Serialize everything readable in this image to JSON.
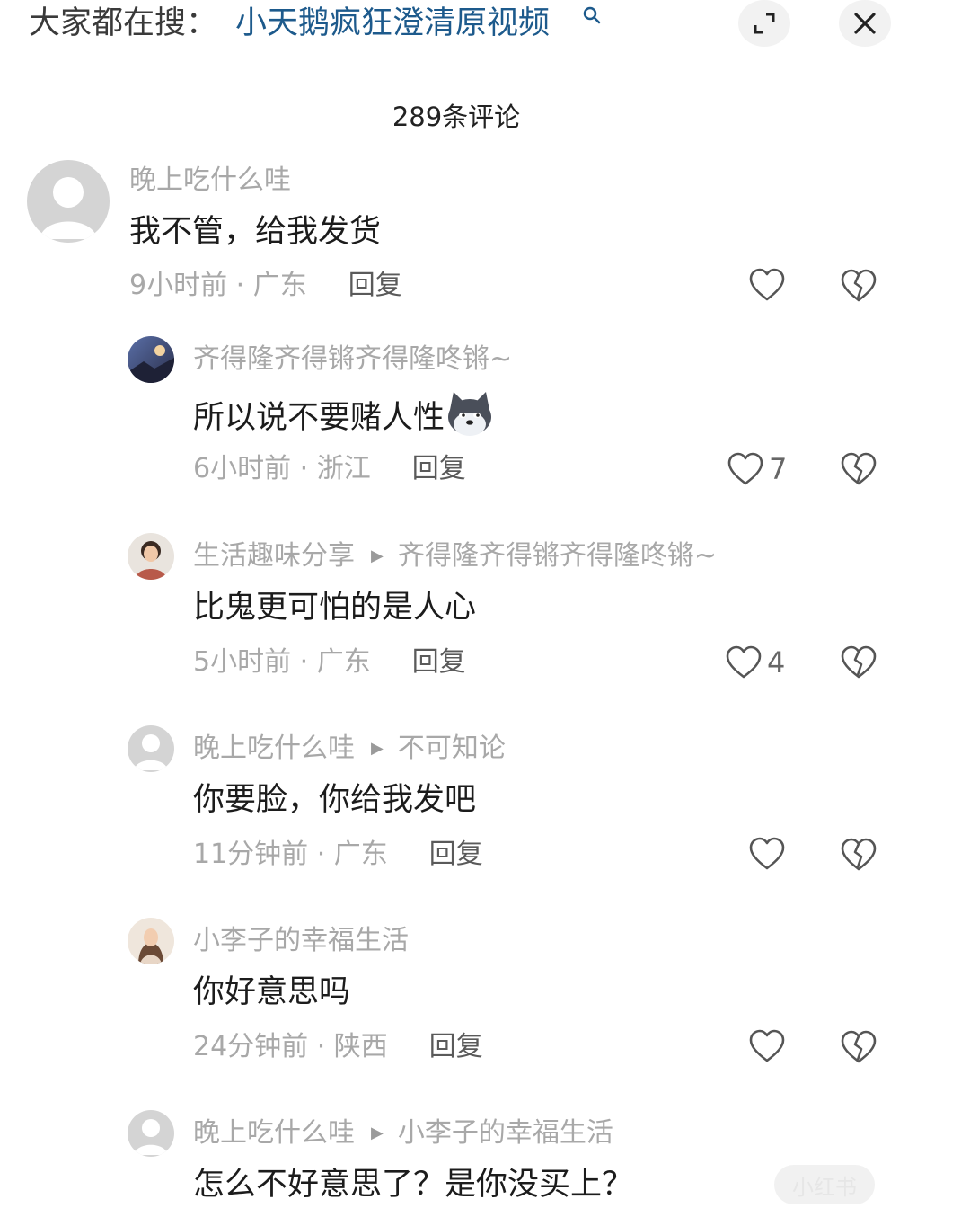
{
  "search": {
    "label": "大家都在搜：",
    "term": "小天鹅疯狂澄清原视频"
  },
  "comments_header": {
    "count_title": "289条评论"
  },
  "comments": [
    {
      "user": "晚上吃什么哇",
      "text": "我不管，给我发货",
      "meta": "9小时前 · 广东",
      "reply": "回复",
      "likes": ""
    },
    {
      "user": "齐得隆齐得锵齐得隆咚锵~",
      "text": "所以说不要赌人性",
      "emoji": "husky-emoji",
      "meta": "6小时前 · 浙江",
      "reply": "回复",
      "likes": "7"
    },
    {
      "user": "生活趣味分享",
      "reply_to": "齐得隆齐得锵齐得隆咚锵~",
      "text": "比鬼更可怕的是人心",
      "meta": "5小时前 · 广东",
      "reply": "回复",
      "likes": "4"
    },
    {
      "user": "晚上吃什么哇",
      "reply_to": "不可知论",
      "text": "你要脸，你给我发吧",
      "meta": "11分钟前 · 广东",
      "reply": "回复",
      "likes": ""
    },
    {
      "user": "小李子的幸福生活",
      "text": "你好意思吗",
      "meta": "24分钟前 · 陕西",
      "reply": "回复",
      "likes": ""
    },
    {
      "user": "晚上吃什么哇",
      "reply_to": "小李子的幸福生活",
      "text": "怎么不好意思了？是你没买上？"
    }
  ],
  "watermark": "小红书",
  "colors": {
    "link": "#1d5a8c",
    "muted": "#a8a8a8",
    "text": "#1c1c1c"
  }
}
